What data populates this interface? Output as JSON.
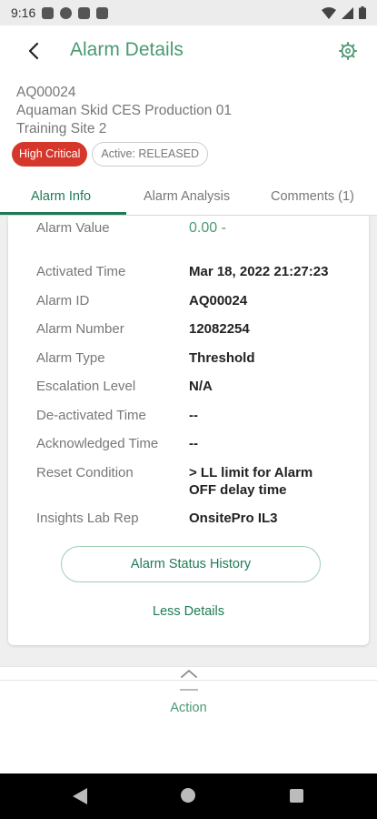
{
  "status_bar": {
    "time": "9:16",
    "icons": [
      "mail-icon",
      "sync-icon",
      "clipboard-icon",
      "sd-card-icon",
      "wifi-icon",
      "signal-icon",
      "battery-icon"
    ]
  },
  "header": {
    "title": "Alarm Details",
    "back_icon": "arrow-left-icon",
    "settings_icon": "gear-icon"
  },
  "alarm": {
    "code": "AQ00024",
    "asset": "Aquaman Skid  CES Production 01",
    "site": "Training Site 2",
    "priority_badge": "High Critical",
    "status_badge": "Active: RELEASED"
  },
  "tabs": [
    {
      "label": "Alarm Info",
      "active": true
    },
    {
      "label": "Alarm Analysis",
      "active": false
    },
    {
      "label": "Comments (1)",
      "active": false
    }
  ],
  "details": {
    "alarm_value": {
      "label": "Alarm Value",
      "value": "0.00 -"
    },
    "rows": [
      {
        "label": "Activated Time",
        "value": "Mar 18, 2022 21:27:23"
      },
      {
        "label": "Alarm ID",
        "value": "AQ00024"
      },
      {
        "label": "Alarm Number",
        "value": "12082254"
      },
      {
        "label": "Alarm Type",
        "value": "Threshold"
      },
      {
        "label": "Escalation Level",
        "value": "N/A"
      },
      {
        "label": "De-activated Time",
        "value": "--"
      },
      {
        "label": "Acknowledged Time",
        "value": "--"
      },
      {
        "label": "Reset Condition",
        "value_line1": "> LL limit for Alarm",
        "value_line2": "OFF delay time"
      },
      {
        "label": "Insights Lab Rep",
        "value": "OnsitePro IL3"
      }
    ]
  },
  "buttons": {
    "status_history": "Alarm Status History",
    "less_details": "Less Details"
  },
  "action": {
    "label": "Action",
    "expand_icon": "chevron-up-icon"
  },
  "colors": {
    "accent": "#1e7a55",
    "accent_light": "#4a9a72",
    "critical": "#d5372b"
  }
}
